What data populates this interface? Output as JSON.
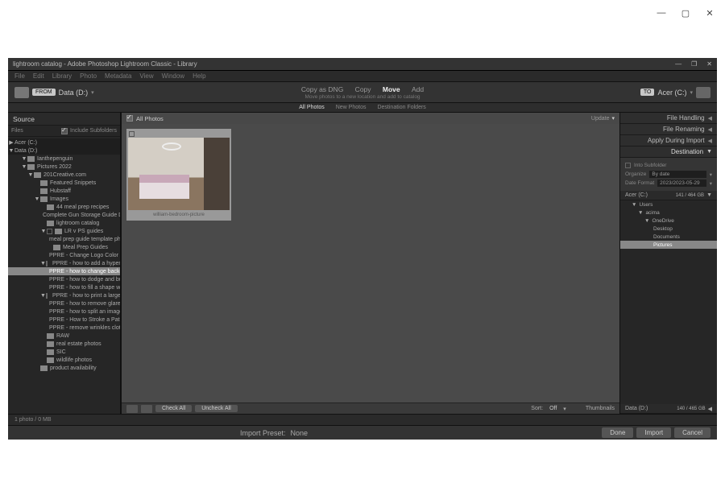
{
  "titlebar": {
    "min": "—",
    "max": "▢",
    "close": "✕"
  },
  "window": {
    "title": "lightroom catalog - Adobe Photoshop Lightroom Classic - Library",
    "controls": {
      "min": "—",
      "max": "❐",
      "close": "✕"
    }
  },
  "menu": [
    "File",
    "Edit",
    "Library",
    "Photo",
    "Metadata",
    "View",
    "Window",
    "Help"
  ],
  "top": {
    "from_badge": "FROM",
    "from_drive": "Data (D:)",
    "actions": [
      "Copy as DNG",
      "Copy",
      "Move",
      "Add"
    ],
    "active_action": "Move",
    "subtitle": "Move photos to a new location and add to catalog",
    "to_badge": "TO",
    "to_drive": "Acer (C:)"
  },
  "subtabs": {
    "items": [
      "All Photos",
      "New Photos",
      "Destination Folders"
    ],
    "active": "All Photos"
  },
  "left": {
    "title": "Source",
    "files_label": "Files",
    "include_subfolders": "Include Subfolders",
    "drives": [
      {
        "label": "Acer (C:)",
        "open": false
      },
      {
        "label": "Data (D:)",
        "open": true
      }
    ],
    "tree": [
      {
        "d": 2,
        "t": "Ianthepenguin",
        "c": true
      },
      {
        "d": 2,
        "t": "Pictures 2022",
        "c": true
      },
      {
        "d": 3,
        "t": "201Creative.com",
        "c": true
      },
      {
        "d": 4,
        "t": "Featured Snippets",
        "f": true
      },
      {
        "d": 4,
        "t": "Hubstaff",
        "f": true
      },
      {
        "d": 4,
        "t": "Images",
        "c": true
      },
      {
        "d": 5,
        "t": "44 meal prep recipes",
        "f": true
      },
      {
        "d": 5,
        "t": "Complete Gun Storage Guide Dove Saf...",
        "f": true
      },
      {
        "d": 5,
        "t": "lightroom catalog",
        "f": true
      },
      {
        "d": 5,
        "t": "LR v PS guides",
        "c": true,
        "chk": true
      },
      {
        "d": 6,
        "t": "meal prep guide template photos",
        "f": true
      },
      {
        "d": 6,
        "t": "Meal Prep Guides",
        "f": true
      },
      {
        "d": 6,
        "t": "PPRE - Change Logo Color",
        "f": true
      },
      {
        "d": 5,
        "t": "PPRE - how to add a hyperlink...",
        "c": true,
        "chk": true
      },
      {
        "d": 6,
        "t": "PPRE - how to change background col...",
        "hl": true,
        "f": true
      },
      {
        "d": 6,
        "t": "PPRE - how to dodge and burn",
        "f": true
      },
      {
        "d": 6,
        "t": "PPRE - how to fill a shape with color",
        "f": true
      },
      {
        "d": 5,
        "t": "PPRE - how to print a large image on ...",
        "c": true,
        "chk": true
      },
      {
        "d": 6,
        "t": "PPRE - how to remove glare lightroom",
        "f": true
      },
      {
        "d": 6,
        "t": "PPRE - how to split an image in half",
        "f": true
      },
      {
        "d": 6,
        "t": "PPRE - How to Stroke a Path",
        "f": true
      },
      {
        "d": 6,
        "t": "PPRE - remove wrinkles clothing",
        "f": true
      },
      {
        "d": 5,
        "t": "RAW",
        "f": true
      },
      {
        "d": 5,
        "t": "real estate photos",
        "f": true
      },
      {
        "d": 5,
        "t": "SIC",
        "f": true
      },
      {
        "d": 5,
        "t": "wildlife photos",
        "f": true
      },
      {
        "d": 4,
        "t": "product availability",
        "f": true
      }
    ]
  },
  "grid": {
    "header": "All Photos",
    "update": "Update",
    "caption": "william-bedroom-picture",
    "check_all": "Check All",
    "uncheck_all": "Uncheck All",
    "sort": "Sort:",
    "sort_val": "Off",
    "thumbs": "Thumbnails"
  },
  "right": {
    "panels": [
      "File Handling",
      "File Renaming",
      "Apply During Import",
      "Destination"
    ],
    "into_sub": "Into Subfolder",
    "organize_l": "Organize",
    "organize_v": "By date",
    "datefmt_l": "Date Format",
    "datefmt_v": "2023/2023-05-29",
    "vol_c": "Acer (C:)",
    "vol_c_free": "141 / 464 GB",
    "dest_tree": [
      {
        "d": 1,
        "t": "Users",
        "c": true
      },
      {
        "d": 2,
        "t": "acima",
        "c": true
      },
      {
        "d": 3,
        "t": "OneDrive",
        "c": true
      },
      {
        "d": 4,
        "t": "Desktop",
        "f": true
      },
      {
        "d": 4,
        "t": "Documents",
        "f": true
      },
      {
        "d": 4,
        "t": "Pictures",
        "f": true,
        "hl": true
      }
    ],
    "vol_d": "Data (D:)",
    "vol_d_free": "140 / 465 GB",
    "plus": "+",
    "minus": "−"
  },
  "status": {
    "left": "1 photo / 0 MB",
    "preset": "Import Preset:",
    "none": "None"
  },
  "buttons": {
    "done": "Done",
    "import": "Import",
    "cancel": "Cancel"
  }
}
